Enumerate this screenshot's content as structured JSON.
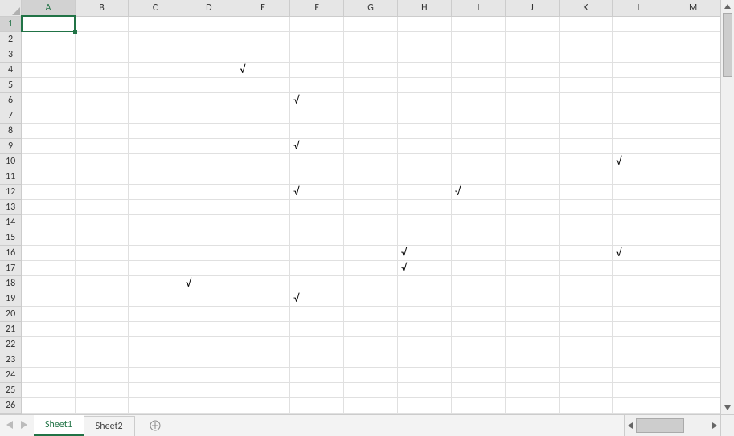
{
  "columns": [
    "A",
    "B",
    "C",
    "D",
    "E",
    "F",
    "G",
    "H",
    "I",
    "J",
    "K",
    "L",
    "M"
  ],
  "row_count": 26,
  "active_cell": {
    "row": 1,
    "col": "A"
  },
  "cell_data": {
    "E4": "√",
    "F6": "√",
    "F9": "√",
    "L10": "√",
    "F12": "√",
    "I12": "√",
    "H16": "√",
    "L16": "√",
    "H17": "√",
    "D18": "√",
    "F19": "√"
  },
  "tabs": {
    "active_index": 0,
    "items": [
      {
        "label": "Sheet1"
      },
      {
        "label": "Sheet2"
      }
    ]
  },
  "chart_data": {
    "type": "table",
    "title": "",
    "columns": [
      "A",
      "B",
      "C",
      "D",
      "E",
      "F",
      "G",
      "H",
      "I",
      "J",
      "K",
      "L"
    ],
    "rows": [
      1,
      2,
      3,
      4,
      5,
      6,
      7,
      8,
      9,
      10,
      11,
      12,
      13,
      14,
      15,
      16,
      17,
      18,
      19,
      20,
      21,
      22,
      23,
      24,
      25,
      26
    ],
    "cells": {
      "E4": "√",
      "F6": "√",
      "F9": "√",
      "L10": "√",
      "F12": "√",
      "I12": "√",
      "H16": "√",
      "L16": "√",
      "H17": "√",
      "D18": "√",
      "F19": "√"
    }
  }
}
